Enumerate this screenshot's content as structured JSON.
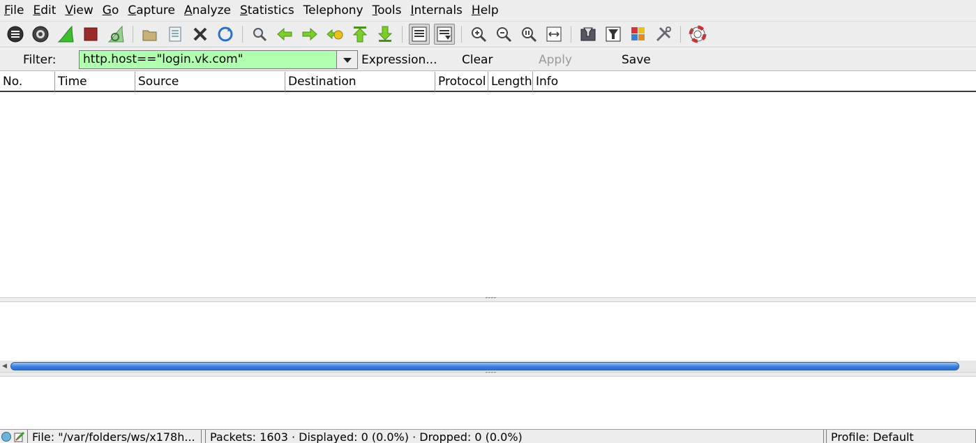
{
  "menu": {
    "items": [
      {
        "mnemonic": "F",
        "rest": "ile"
      },
      {
        "mnemonic": "E",
        "rest": "dit"
      },
      {
        "mnemonic": "V",
        "rest": "iew"
      },
      {
        "mnemonic": "G",
        "rest": "o"
      },
      {
        "mnemonic": "C",
        "rest": "apture"
      },
      {
        "mnemonic": "A",
        "rest": "nalyze"
      },
      {
        "mnemonic": "S",
        "rest": "tatistics"
      },
      {
        "mnemonic": "",
        "rest": "Telephony"
      },
      {
        "mnemonic": "T",
        "rest": "ools"
      },
      {
        "mnemonic": "I",
        "rest": "nternals"
      },
      {
        "mnemonic": "H",
        "rest": "elp"
      }
    ]
  },
  "filter": {
    "label": "Filter:",
    "value": "http.host==\"login.vk.com\"",
    "expression_label": "Expression...",
    "clear_label": "Clear",
    "apply_label": "Apply",
    "save_label": "Save"
  },
  "packet_list": {
    "columns": [
      "No.",
      "Time",
      "Source",
      "Destination",
      "Protocol",
      "Length",
      "Info"
    ]
  },
  "statusbar": {
    "file": "File: \"/var/folders/ws/x178h...",
    "packets": "Packets: 1603 · Displayed: 0 (0.0%)  · Dropped: 0 (0.0%)",
    "profile": "Profile: Default"
  },
  "colors": {
    "filter_valid_bg": "#afffaf",
    "scroll_thumb": "#3a7fdc",
    "shark_fin": "#3fbf2f"
  }
}
